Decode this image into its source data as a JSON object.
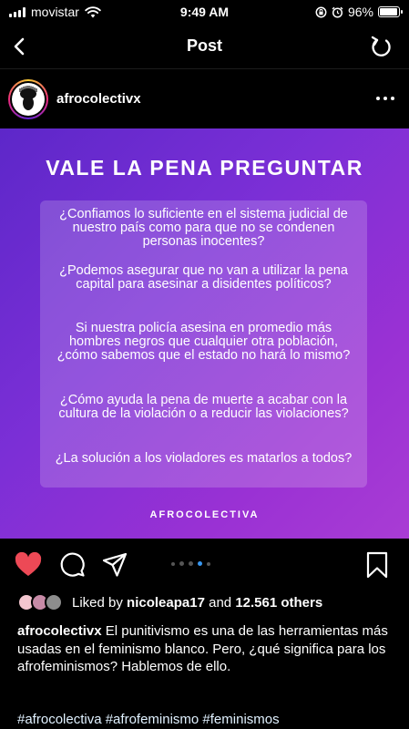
{
  "status_bar": {
    "carrier": "movistar",
    "time": "9:49 AM",
    "battery": "96%",
    "battery_level": 0.96,
    "icons": [
      "signal-icon",
      "wifi-icon",
      "orientation-lock-icon",
      "alarm-icon",
      "battery-icon"
    ]
  },
  "nav": {
    "title": "Post",
    "back_icon": "chevron-left-icon",
    "refresh_icon": "refresh-icon"
  },
  "post": {
    "username": "afrocolectivx",
    "more_icon": "more-horizontal-icon",
    "image": {
      "heading": "VALE LA PENA PREGUNTAR",
      "questions": [
        "¿Confiamos lo suficiente en el sistema judicial de nuestro país como para que no se condenen personas inocentes?",
        "¿Podemos asegurar que no van a utilizar la pena capital para asesinar a disidentes políticos?",
        "Si nuestra policía asesina en promedio más hombres negros que cualquier otra población, ¿cómo sabemos que el estado no hará lo mismo?",
        "¿Cómo ayuda la pena de muerte a acabar con la cultura de la violación o a reducir las violaciones?",
        "¿La solución a los violadores es matarlos a todos?"
      ],
      "brand": "AFROCOLECTIVA",
      "colors": {
        "gradient_start": "#5d27c9",
        "gradient_end": "#a93cd4"
      }
    },
    "actions": {
      "like_icon": "heart-filled-icon",
      "comment_icon": "comment-icon",
      "share_icon": "send-icon",
      "save_icon": "bookmark-icon",
      "carousel_total": 5,
      "carousel_active": 4
    },
    "likes": {
      "prefix": "Liked by",
      "user": "nicoleapa17",
      "conjunction": "and",
      "others": "12.561 others"
    },
    "caption": {
      "username": "afrocolectivx",
      "text": "El punitivismo es una de las herramientas más usadas en el feminismo blanco. Pero, ¿qué significa para los afrofeminismos? Hablemos de ello."
    },
    "hashtags": "#afrocolectiva #afrofeminismo #feminismos"
  },
  "colors": {
    "like_red": "#ed4956",
    "accent_blue": "#3897f0",
    "background": "#000000"
  }
}
